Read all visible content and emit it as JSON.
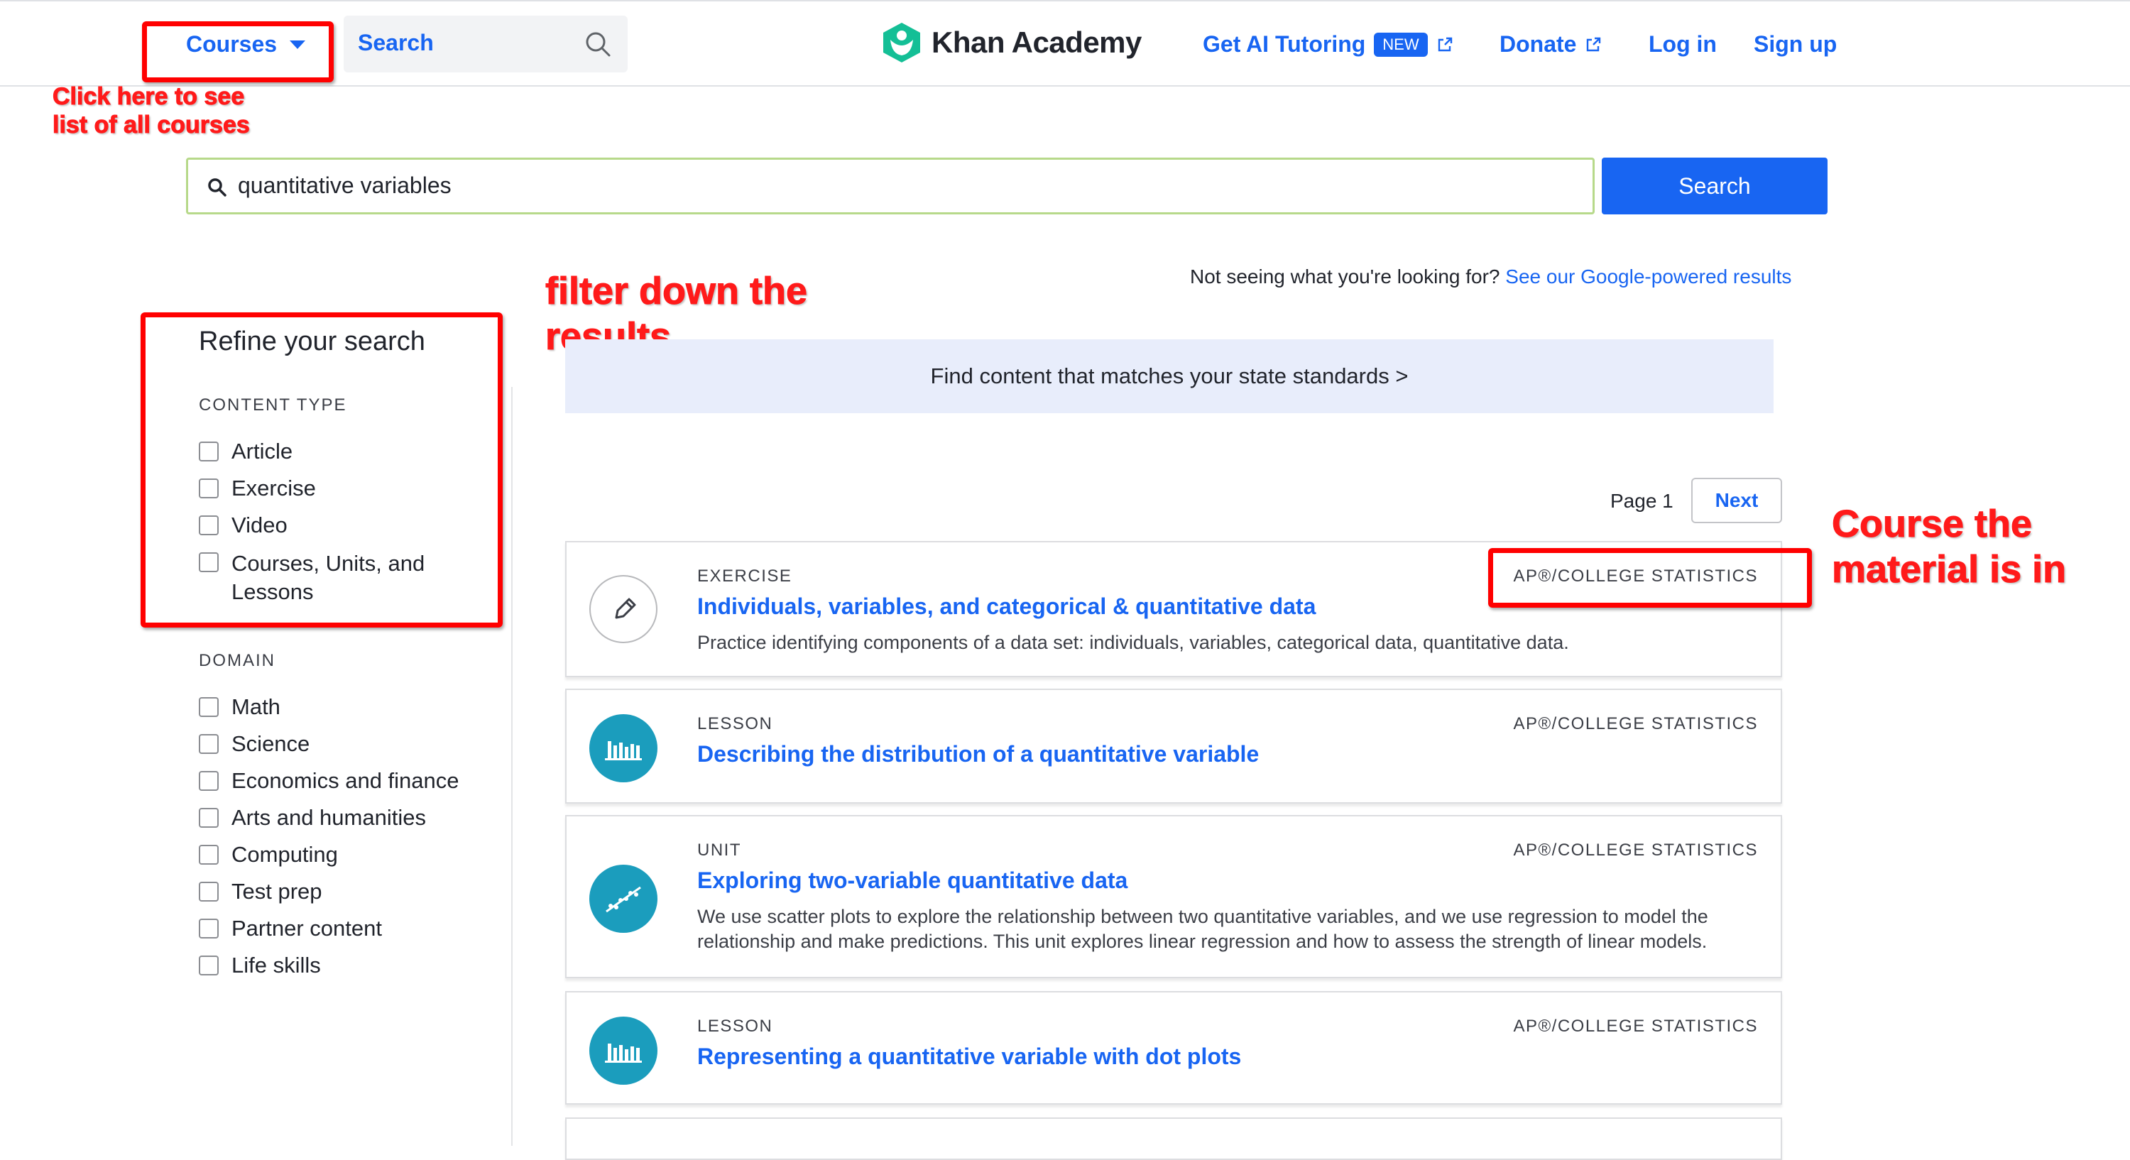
{
  "header": {
    "courses_label": "Courses",
    "search_label": "Search",
    "logo_text": "Khan Academy",
    "ai_tutoring_label": "Get AI Tutoring",
    "new_badge": "NEW",
    "donate_label": "Donate",
    "login_label": "Log in",
    "signup_label": "Sign up"
  },
  "search": {
    "query": "quantitative variables",
    "button_label": "Search"
  },
  "annotations": {
    "courses_note_line1": "Click here to see",
    "courses_note_line2": "list of all courses",
    "filter_note_line1": "filter down the",
    "filter_note_line2": "results",
    "course_note_line1": "Course the",
    "course_note_line2": "material is in"
  },
  "sidebar": {
    "title": "Refine your search",
    "content_type_heading": "CONTENT TYPE",
    "content_types": [
      "Article",
      "Exercise",
      "Video",
      "Courses, Units, and Lessons"
    ],
    "domain_heading": "DOMAIN",
    "domains": [
      "Math",
      "Science",
      "Economics and finance",
      "Arts and humanities",
      "Computing",
      "Test prep",
      "Partner content",
      "Life skills"
    ]
  },
  "results": {
    "not_seeing_text": "Not seeing what you're looking for?",
    "google_link": "See our Google-powered results",
    "standards_banner": "Find content that matches your state standards >",
    "page_label": "Page 1",
    "next_label": "Next",
    "items": [
      {
        "type": "EXERCISE",
        "course": "AP®/COLLEGE STATISTICS",
        "title": "Individuals, variables, and categorical & quantitative data",
        "description": "Practice identifying components of a data set: individuals, variables, categorical data, quantitative data.",
        "icon": "pencil-icon"
      },
      {
        "type": "LESSON",
        "course": "AP®/COLLEGE STATISTICS",
        "title": "Describing the distribution of a quantitative variable",
        "description": "",
        "icon": "bar-chart-icon"
      },
      {
        "type": "UNIT",
        "course": "AP®/COLLEGE STATISTICS",
        "title": "Exploring two-variable quantitative data",
        "description": "We use scatter plots to explore the relationship between two quantitative variables, and we use regression to model the relationship and make predictions. This unit explores linear regression and how to assess the strength of linear models.",
        "icon": "scatter-plot-icon"
      },
      {
        "type": "LESSON",
        "course": "AP®/COLLEGE STATISTICS",
        "title": "Representing a quantitative variable with dot plots",
        "description": "",
        "icon": "bar-chart-icon"
      }
    ]
  },
  "colors": {
    "brand_blue": "#1865f2",
    "annotation_red": "#ff0000",
    "teal": "#1b9dbd",
    "logo_green": "#14bf96"
  }
}
